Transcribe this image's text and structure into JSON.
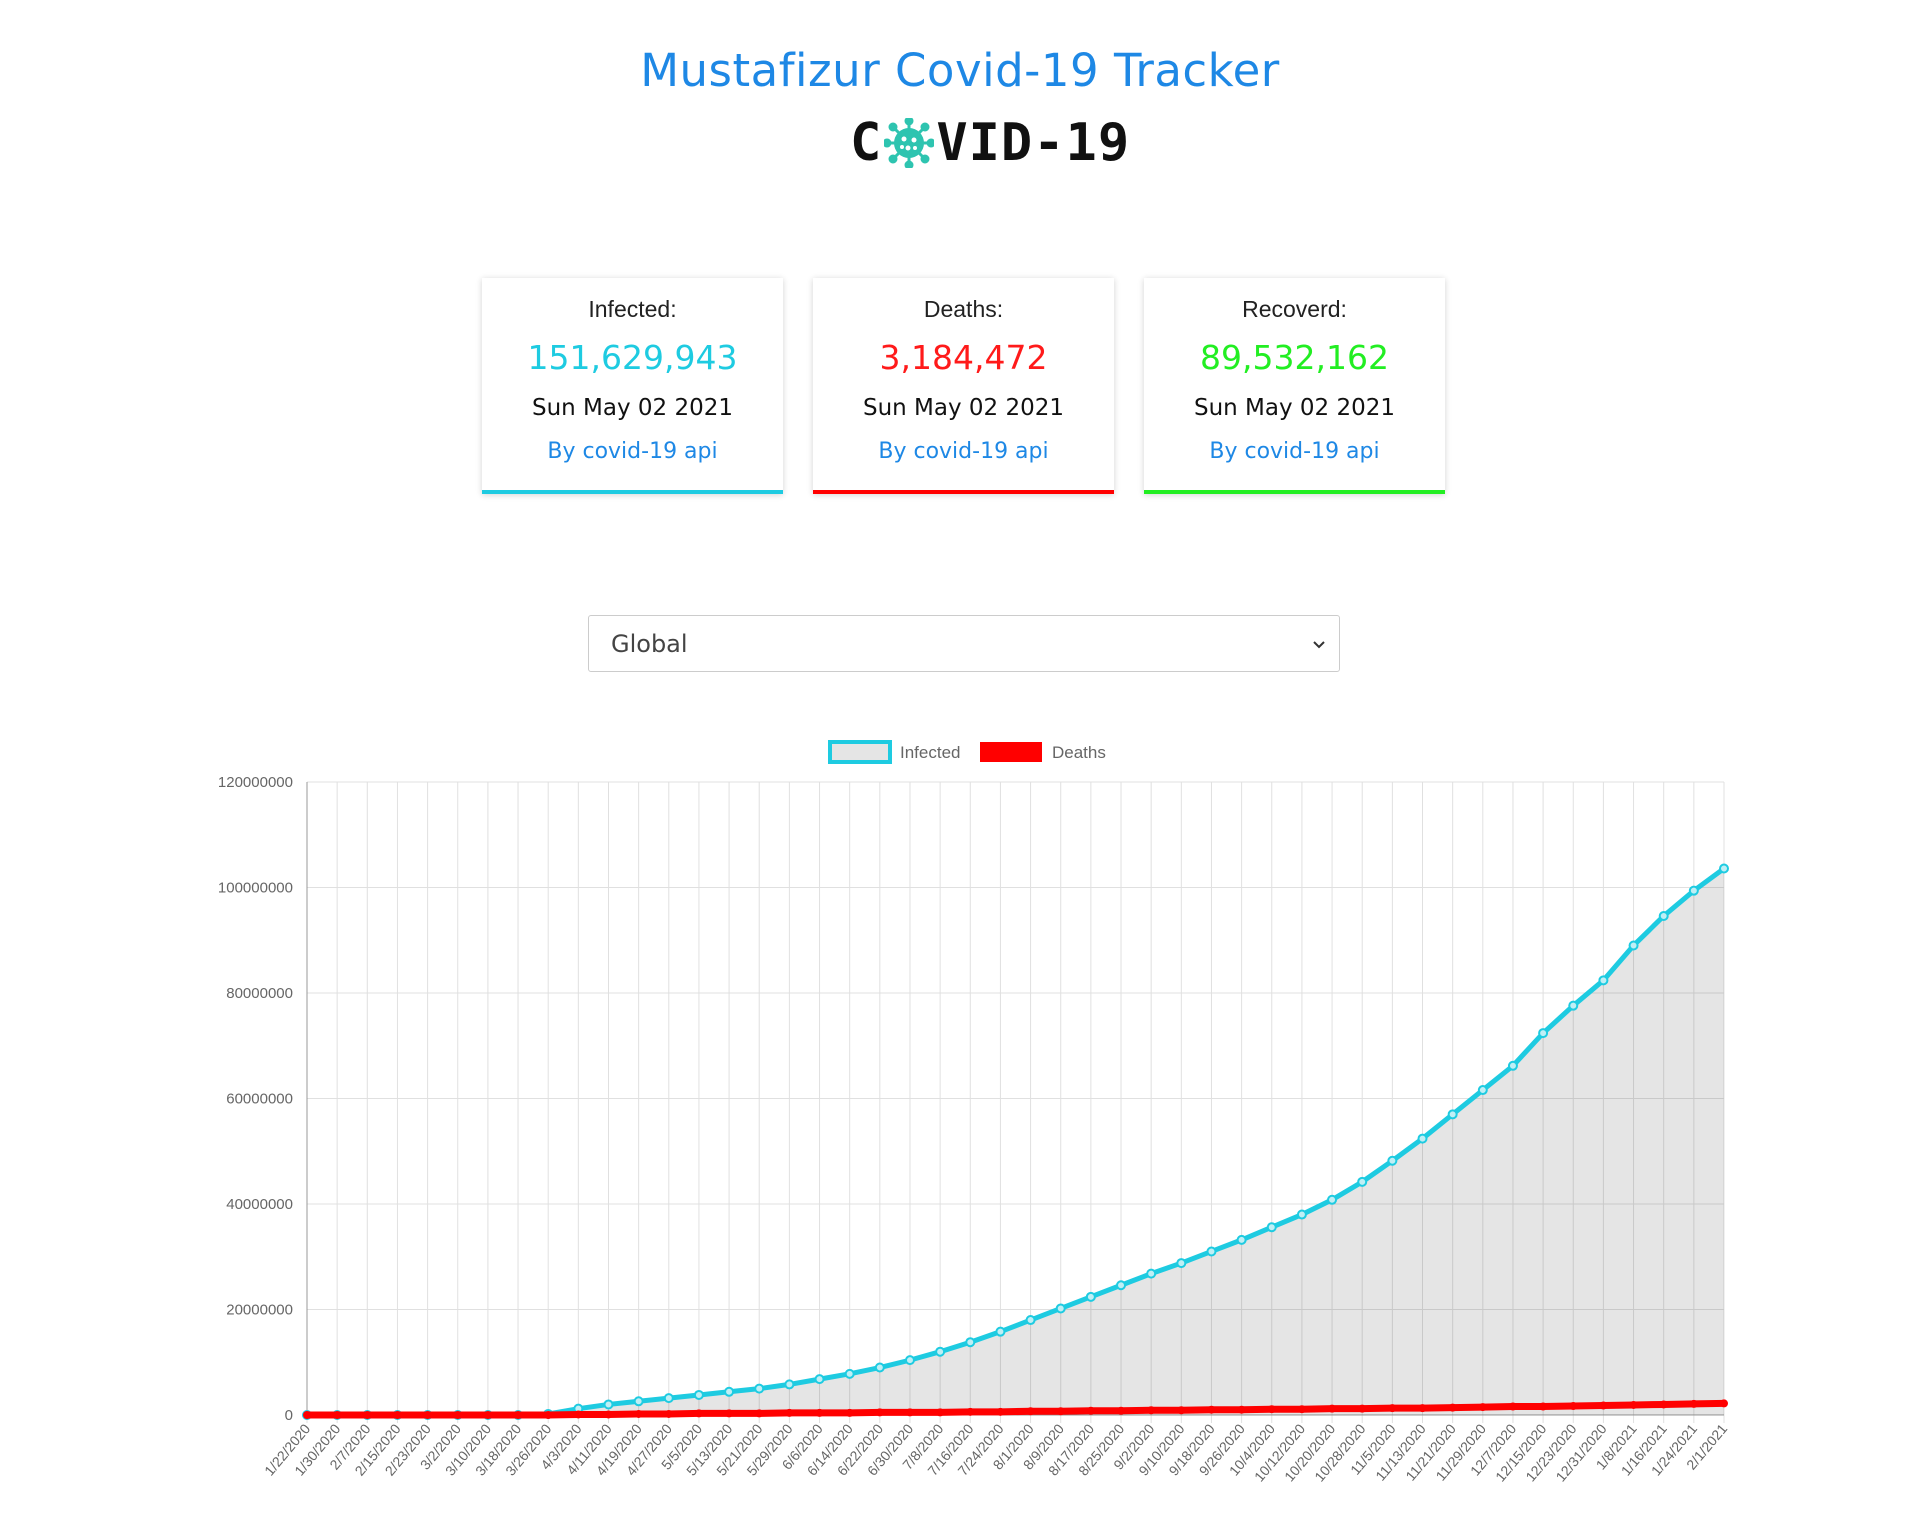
{
  "header": {
    "title": "Mustafizur Covid-19 Tracker",
    "logo_left": "C",
    "logo_right": "VID-19"
  },
  "colors": {
    "infected": "#1ecbe1",
    "deaths": "#ff0000",
    "recovered": "#22ee22",
    "link": "#1e88e5"
  },
  "cards": [
    {
      "label": "Infected:",
      "value": "151,629,943",
      "date": "Sun May 02 2021",
      "source": "By covid-19 api"
    },
    {
      "label": "Deaths:",
      "value": "3,184,472",
      "date": "Sun May 02 2021",
      "source": "By covid-19 api"
    },
    {
      "label": "Recoverd:",
      "value": "89,532,162",
      "date": "Sun May 02 2021",
      "source": "By covid-19 api"
    }
  ],
  "country_select": {
    "selected": "Global",
    "icon": "chevron-down-icon"
  },
  "chart_data": {
    "type": "area",
    "legend_position": "top",
    "grid": true,
    "ylim": [
      0,
      120000000
    ],
    "yticks": [
      0,
      20000000,
      40000000,
      60000000,
      80000000,
      100000000,
      120000000
    ],
    "x_tick_labels": [
      "1/22/2020",
      "1/30/2020",
      "2/7/2020",
      "2/15/2020",
      "2/23/2020",
      "3/2/2020",
      "3/10/2020",
      "3/18/2020",
      "3/26/2020",
      "4/3/2020",
      "4/11/2020",
      "4/19/2020",
      "4/27/2020",
      "5/5/2020",
      "5/13/2020",
      "5/21/2020",
      "5/29/2020",
      "6/6/2020",
      "6/14/2020",
      "6/22/2020",
      "6/30/2020",
      "7/8/2020",
      "7/16/2020",
      "7/24/2020",
      "8/1/2020",
      "8/9/2020",
      "8/17/2020",
      "8/25/2020",
      "9/2/2020",
      "9/10/2020",
      "9/18/2020",
      "9/26/2020",
      "10/4/2020",
      "10/12/2020",
      "10/20/2020",
      "10/28/2020",
      "11/5/2020",
      "11/13/2020",
      "11/21/2020",
      "11/29/2020",
      "12/7/2020",
      "12/15/2020",
      "12/23/2020",
      "12/31/2020",
      "1/8/2021",
      "1/16/2021",
      "1/24/2021",
      "2/1/2021"
    ],
    "series": [
      {
        "name": "Infected",
        "values": [
          0,
          0,
          0,
          0,
          0,
          0,
          0,
          0,
          0.2,
          1.2,
          2.0,
          2.6,
          3.2,
          3.8,
          4.4,
          5.0,
          5.8,
          6.8,
          7.8,
          9.0,
          10.4,
          12.0,
          13.8,
          15.8,
          18.0,
          20.2,
          22.4,
          24.6,
          26.8,
          28.8,
          31.0,
          33.2,
          35.6,
          38.0,
          40.8,
          44.2,
          48.2,
          52.4,
          57.0,
          61.6,
          66.2,
          72.4,
          77.6,
          82.4,
          89.0,
          94.6,
          99.4,
          103.6
        ]
      },
      {
        "name": "Deaths",
        "values": [
          0,
          0,
          0,
          0,
          0,
          0,
          0,
          0,
          0,
          0.1,
          0.1,
          0.2,
          0.2,
          0.3,
          0.3,
          0.3,
          0.4,
          0.4,
          0.4,
          0.5,
          0.5,
          0.5,
          0.6,
          0.6,
          0.7,
          0.7,
          0.8,
          0.8,
          0.9,
          0.9,
          1.0,
          1.0,
          1.1,
          1.1,
          1.2,
          1.2,
          1.3,
          1.3,
          1.4,
          1.5,
          1.6,
          1.6,
          1.7,
          1.8,
          1.9,
          2.0,
          2.1,
          2.2
        ]
      }
    ],
    "value_scale_note": ""
  }
}
